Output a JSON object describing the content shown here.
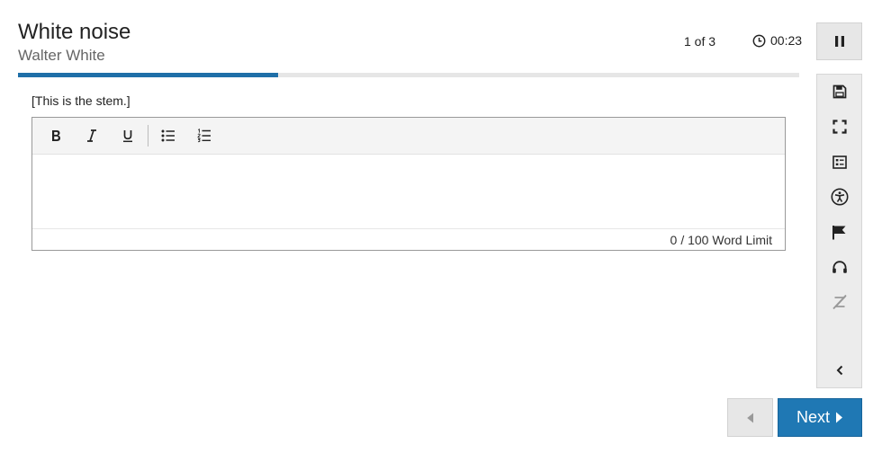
{
  "header": {
    "title": "White noise",
    "subtitle": "Walter White",
    "counter": "1 of 3",
    "timer": "00:23"
  },
  "progress": {
    "fraction": 0.333
  },
  "stem": "[This is the stem.]",
  "editor": {
    "toolbar": [
      "bold-icon",
      "italic-icon",
      "underline-icon",
      "bulleted-list-icon",
      "numbered-list-icon"
    ],
    "value": "",
    "word_count": "0",
    "word_limit": "/ 100 Word Limit"
  },
  "sidebar": {
    "icons": [
      "save-icon",
      "fullscreen-icon",
      "notes-icon",
      "accessibility-icon",
      "flag-icon",
      "headphones-icon",
      "eliminate-choice-icon",
      "collapse-chevron-icon"
    ]
  },
  "nav": {
    "next_label": "Next"
  },
  "colors": {
    "accent": "#1f78b4",
    "progress": "#1f6fa8"
  }
}
